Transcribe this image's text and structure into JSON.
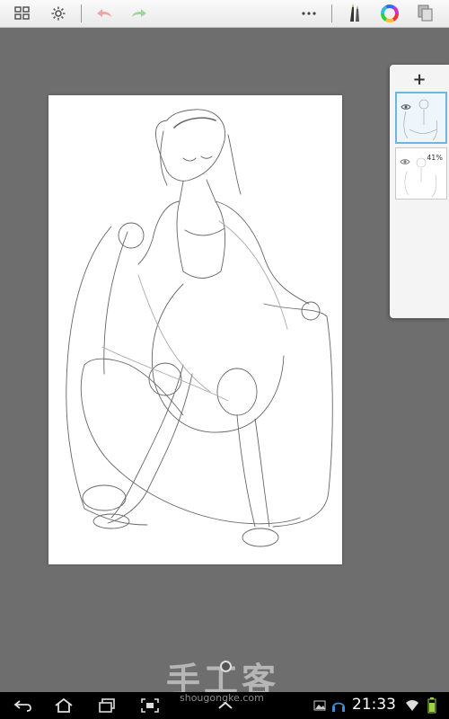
{
  "toolbar": {
    "icons": [
      "gallery-icon",
      "settings-icon",
      "undo-icon",
      "redo-icon",
      "more-icon",
      "brush-icon",
      "color-wheel-icon",
      "layers-copy-icon"
    ],
    "accent_undo": "#f2a3a3",
    "accent_redo": "#9ed69e"
  },
  "layers_panel": {
    "add_label": "+",
    "layers": [
      {
        "active": true,
        "opacity": ""
      },
      {
        "active": false,
        "opacity": "41%"
      }
    ]
  },
  "watermark": {
    "title": "手工客",
    "url": "shougongke.com"
  },
  "status_bar": {
    "time": "21:33"
  }
}
